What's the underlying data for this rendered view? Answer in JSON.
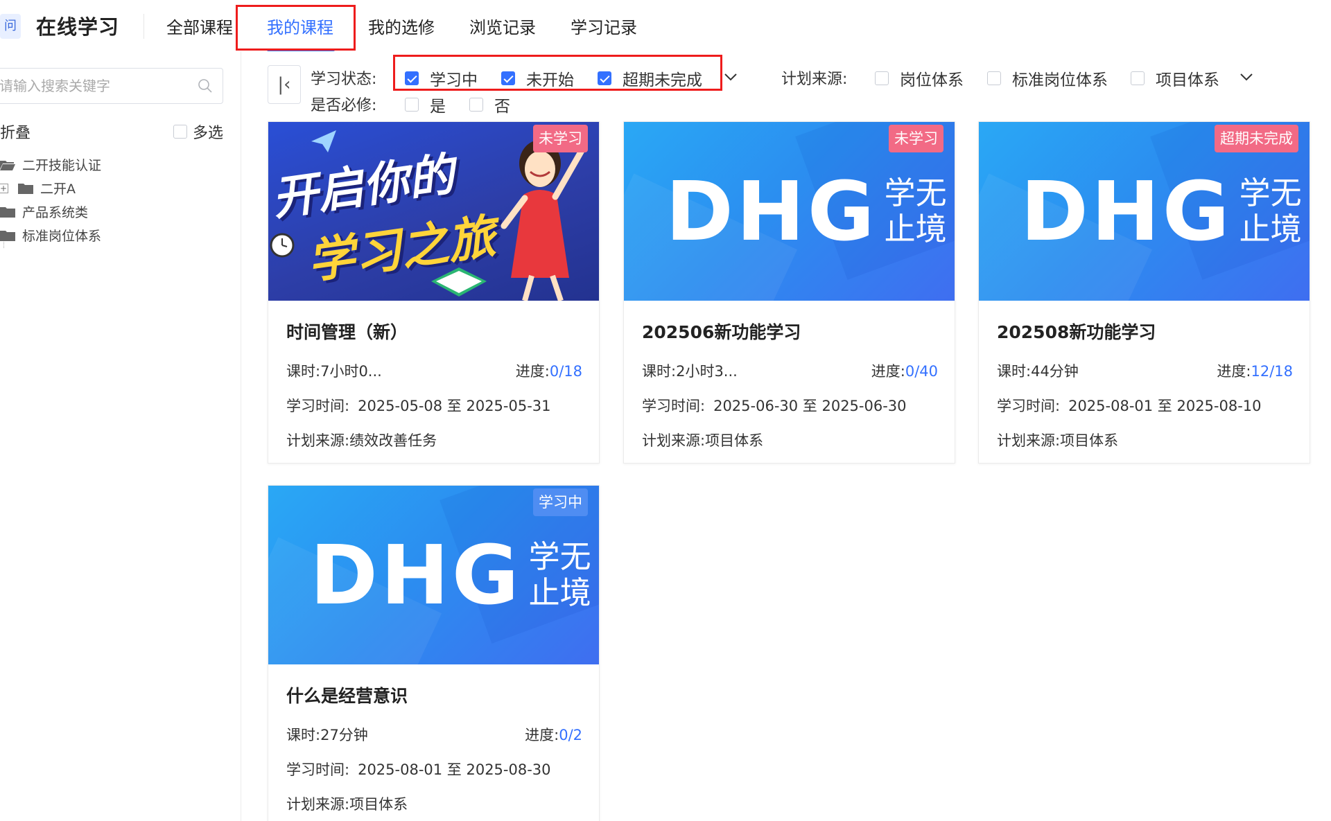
{
  "app": {
    "logo_glyph": "问",
    "title": "在线学习"
  },
  "nav": {
    "tabs": [
      {
        "label": "全部课程"
      },
      {
        "label": "我的课程",
        "active": true
      },
      {
        "label": "我的选修"
      },
      {
        "label": "浏览记录"
      },
      {
        "label": "学习记录"
      }
    ]
  },
  "sidebar": {
    "search_placeholder": "请输入搜索关键字",
    "collapse_label": "折叠",
    "multi_select_label": "多选",
    "tree": [
      {
        "label": "二开技能认证",
        "icon": "folder-open-icon"
      },
      {
        "label": "二开A",
        "icon": "folder-icon",
        "expandable": true
      },
      {
        "label": "产品系统类",
        "icon": "folder-icon"
      },
      {
        "label": "标准岗位体系",
        "icon": "folder-icon"
      }
    ]
  },
  "filters": {
    "status_label": "学习状态:",
    "status_options": [
      {
        "label": "学习中",
        "checked": true
      },
      {
        "label": "未开始",
        "checked": true
      },
      {
        "label": "超期未完成",
        "checked": true
      }
    ],
    "source_label": "计划来源:",
    "source_options": [
      {
        "label": "岗位体系",
        "checked": false
      },
      {
        "label": "标准岗位体系",
        "checked": false
      },
      {
        "label": "项目体系",
        "checked": false
      }
    ],
    "required_label": "是否必修:",
    "required_options": [
      {
        "label": "是",
        "checked": false
      },
      {
        "label": "否",
        "checked": false
      }
    ]
  },
  "cards": [
    {
      "title": "时间管理（新）",
      "badge": "未学习",
      "cover": "illustration",
      "cover_line1": "开启你的",
      "cover_line2": "学习之旅",
      "hours_label": "课时:",
      "hours": "7小时0...",
      "progress_label": "进度:",
      "progress": "0/18",
      "time_label": "学习时间:",
      "time": "2025-05-08 至 2025-05-31",
      "source_label": "计划来源:",
      "source": "绩效改善任务"
    },
    {
      "title": "202506新功能学习",
      "badge": "未学习",
      "cover": "dhg",
      "hours_label": "课时:",
      "hours": "2小时3...",
      "progress_label": "进度:",
      "progress": "0/40",
      "time_label": "学习时间:",
      "time": "2025-06-30 至 2025-06-30",
      "source_label": "计划来源:",
      "source": "项目体系"
    },
    {
      "title": "202508新功能学习",
      "badge": "超期未完成",
      "cover": "dhg",
      "hours_label": "课时:",
      "hours": "44分钟",
      "progress_label": "进度:",
      "progress": "12/18",
      "time_label": "学习时间:",
      "time": "2025-08-01 至 2025-08-10",
      "source_label": "计划来源:",
      "source": "项目体系"
    },
    {
      "title": "什么是经营意识",
      "badge": "学习中",
      "cover": "dhg",
      "hours_label": "课时:",
      "hours": "27分钟",
      "progress_label": "进度:",
      "progress": "0/2",
      "time_label": "学习时间:",
      "time": "2025-08-01 至 2025-08-30",
      "source_label": "计划来源:",
      "source": "项目体系"
    }
  ],
  "dhg_cover": {
    "letters": "DHG",
    "slogan_line1": "学无",
    "slogan_line2": "止境"
  },
  "colors": {
    "accent": "#3370ff",
    "badge_pink": "#f26a85",
    "badge_blue": "#4f8df2",
    "highlight_box": "#ee1c1c"
  }
}
